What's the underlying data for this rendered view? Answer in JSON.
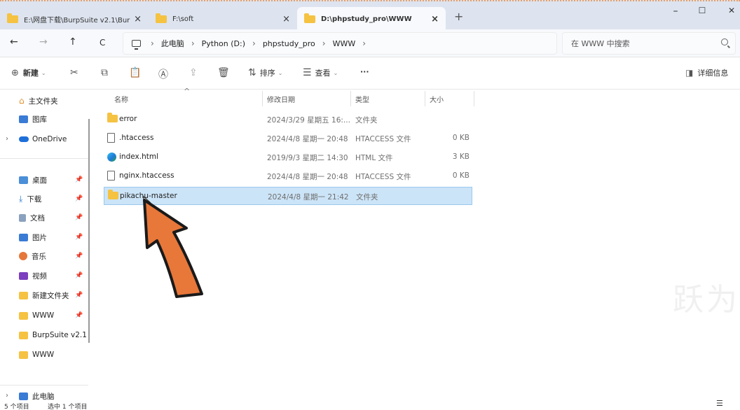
{
  "tabs": [
    {
      "title": "E:\\网盘下载\\BurpSuite v2.1\\Bur",
      "close": "×"
    },
    {
      "title": "F:\\soft",
      "close": "×"
    },
    {
      "title": "D:\\phpstudy_pro\\WWW",
      "close": "×"
    }
  ],
  "new_tab": "+",
  "window_controls": {
    "minimize": "–",
    "maximize": "☐",
    "close": "✕"
  },
  "nav": {
    "back": "←",
    "forward": "→",
    "up": "↑",
    "refresh": "C"
  },
  "breadcrumb": [
    "此电脑",
    "Python (D:)",
    "phpstudy_pro",
    "WWW"
  ],
  "breadcrumb_sep": "›",
  "search": {
    "placeholder": "在 WWW 中搜索"
  },
  "toolbar": {
    "new_label": "新建",
    "sort_label": "排序",
    "view_label": "查看",
    "more": "···",
    "details_label": "详细信息"
  },
  "columns": {
    "name": "名称",
    "date": "修改日期",
    "type": "类型",
    "size": "大小"
  },
  "files": [
    {
      "icon": "folder-icon",
      "name": "error",
      "date": "2024/3/29 星期五 16:...",
      "type": "文件夹",
      "size": ""
    },
    {
      "icon": "file-icon",
      "name": ".htaccess",
      "date": "2024/4/8 星期一 20:48",
      "type": "HTACCESS 文件",
      "size": "0 KB"
    },
    {
      "icon": "edge-icon",
      "name": "index.html",
      "date": "2019/9/3 星期二 14:30",
      "type": "HTML 文件",
      "size": "3 KB"
    },
    {
      "icon": "file-icon",
      "name": "nginx.htaccess",
      "date": "2024/4/8 星期一 20:48",
      "type": "HTACCESS 文件",
      "size": "0 KB"
    },
    {
      "icon": "folder-icon",
      "name": "pikachu-master",
      "date": "2024/4/8 星期一 21:42",
      "type": "文件夹",
      "size": ""
    }
  ],
  "sidebar": {
    "top": [
      {
        "label": "主文件夹",
        "icon": "home-icon"
      },
      {
        "label": "图库",
        "icon": "gallery-icon"
      },
      {
        "label": "OneDrive",
        "icon": "cloud-icon"
      }
    ],
    "quick": [
      {
        "label": "桌面",
        "icon": "desktop-icon"
      },
      {
        "label": "下载",
        "icon": "download-icon"
      },
      {
        "label": "文档",
        "icon": "document-icon"
      },
      {
        "label": "图片",
        "icon": "picture-icon"
      },
      {
        "label": "音乐",
        "icon": "music-icon"
      },
      {
        "label": "视频",
        "icon": "video-icon"
      },
      {
        "label": "新建文件夹",
        "icon": "folder-icon"
      },
      {
        "label": "WWW",
        "icon": "folder-icon"
      },
      {
        "label": "BurpSuite v2.1",
        "icon": "folder-icon"
      },
      {
        "label": "WWW",
        "icon": "folder-icon"
      }
    ],
    "bottom": [
      {
        "label": "此电脑",
        "icon": "computer-icon"
      }
    ]
  },
  "status": {
    "count": "5 个项目",
    "selected": "选中 1 个项目"
  },
  "watermark": "跃为",
  "colors": {
    "selection": "#cce4f7",
    "annotation_arrow": "#e8773a",
    "folder": "#f5c242"
  }
}
